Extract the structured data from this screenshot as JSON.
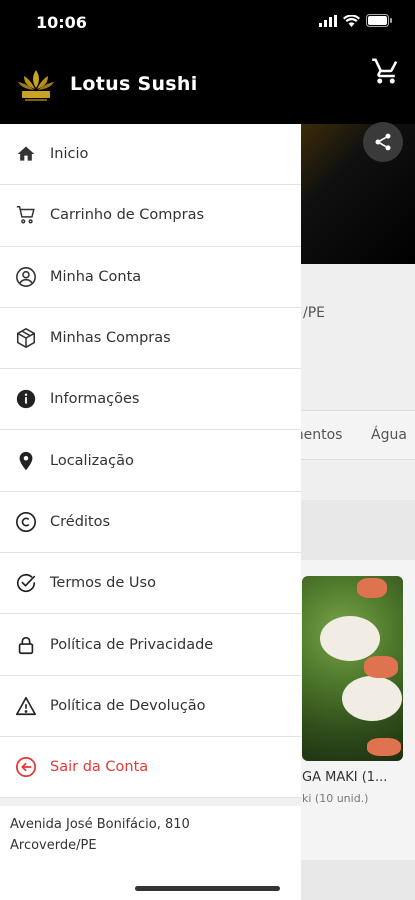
{
  "status_bar": {
    "time": "10:06"
  },
  "brand": {
    "name": "Lotus Sushi"
  },
  "menu": [
    {
      "label": "Inicio",
      "icon": "home-icon"
    },
    {
      "label": "Carrinho de Compras",
      "icon": "cart-icon"
    },
    {
      "label": "Minha Conta",
      "icon": "account-circle-icon"
    },
    {
      "label": "Minhas Compras",
      "icon": "package-icon"
    },
    {
      "label": "Informações",
      "icon": "info-icon"
    },
    {
      "label": "Localização",
      "icon": "location-pin-icon"
    },
    {
      "label": "Créditos",
      "icon": "copyright-icon"
    },
    {
      "label": "Termos de Uso",
      "icon": "check-circle-icon"
    },
    {
      "label": "Política de Privacidade",
      "icon": "lock-icon"
    },
    {
      "label": "Política de Devolução",
      "icon": "warning-icon"
    },
    {
      "label": "Sair da Conta",
      "icon": "logout-icon"
    }
  ],
  "address": {
    "line1": "Avenida José Bonifácio, 810",
    "line2": "Arcoverde/PE"
  },
  "background": {
    "info_fragment": "/PE",
    "tabs": [
      "mentos",
      "Água"
    ],
    "product_title": "GA MAKI (1...",
    "product_sub": "ki (10 unid.)"
  },
  "colors": {
    "danger": "#e53935",
    "header": "#000000",
    "accent": "#c9a227"
  }
}
